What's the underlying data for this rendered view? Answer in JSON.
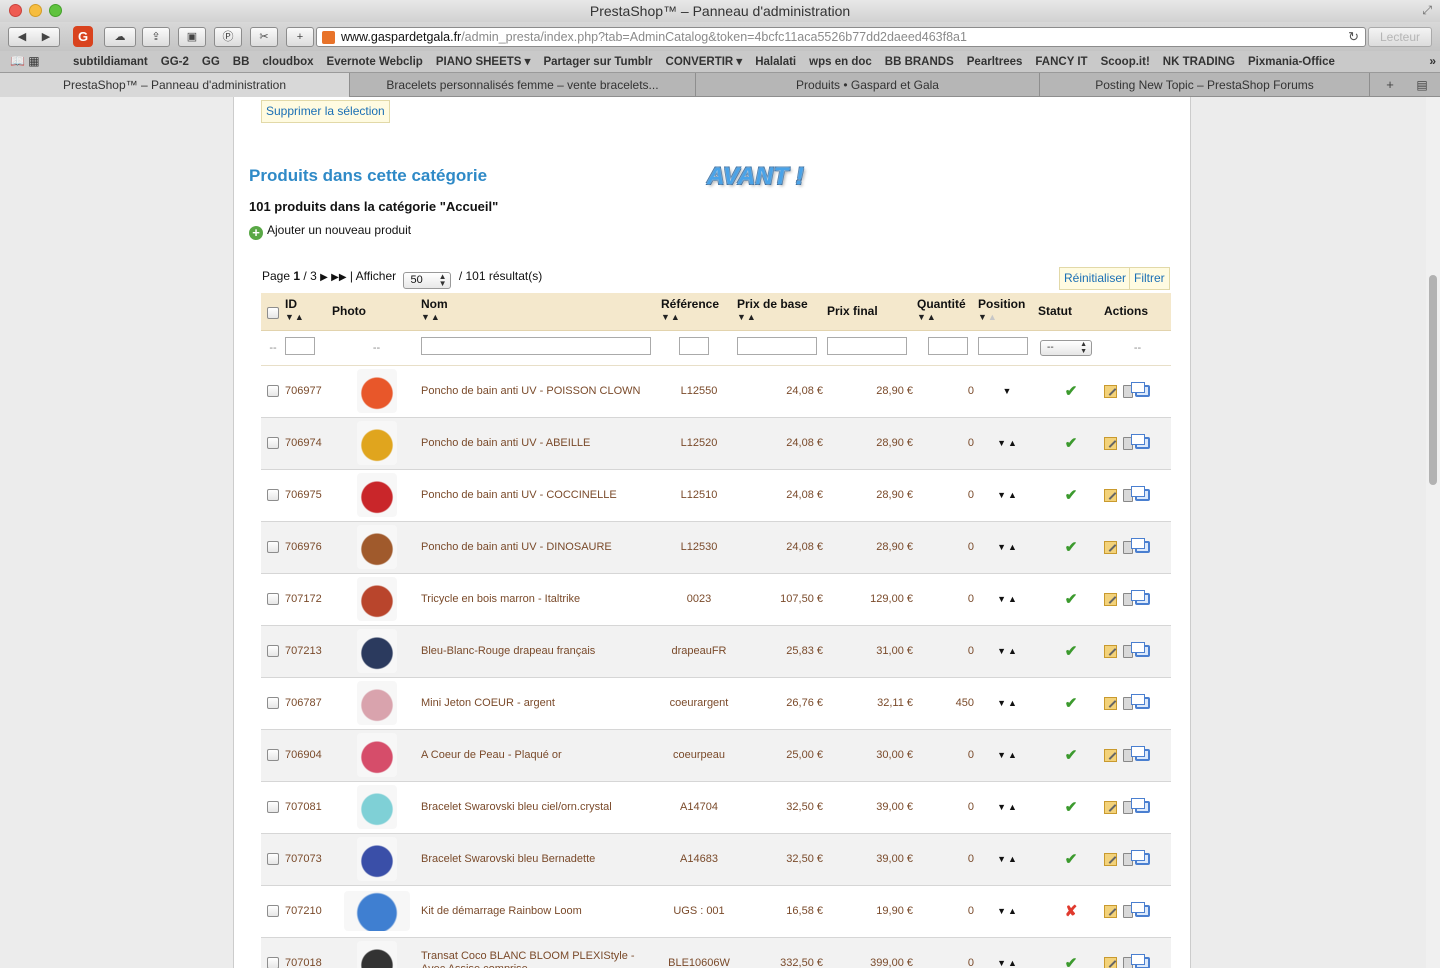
{
  "window": {
    "title": "PrestaShop™ – Panneau d'administration"
  },
  "toolbar": {
    "url_host": "www.gaspardetgala.fr",
    "url_path": "/admin_presta/index.php?tab=AdminCatalog&token=4bcfc11aca5526b77dd2daeed463f8a1",
    "reader_label": "Lecteur"
  },
  "bookmarks": [
    "subtildiamant",
    "GG-2",
    "GG",
    "BB",
    "cloudbox",
    "Evernote Webclip",
    "PIANO SHEETS ▾",
    "Partager sur Tumblr",
    "CONVERTIR ▾",
    "Halalati",
    "wps en doc",
    "BB BRANDS",
    "Pearltrees",
    "FANCY IT",
    "Scoop.it!",
    "NK TRADING",
    "Pixmania-Office"
  ],
  "tabs": [
    {
      "label": "PrestaShop™ – Panneau d'administration",
      "active": true
    },
    {
      "label": "Bracelets personnalisés femme – vente bracelets...",
      "active": false
    },
    {
      "label": "Produits • Gaspard et Gala",
      "active": false
    },
    {
      "label": "Posting New Topic – PrestaShop Forums",
      "active": false
    }
  ],
  "page": {
    "delete_selection": "Supprimer la sélection",
    "section_title": "Produits dans cette catégorie",
    "annotation": "AVANT !",
    "subtitle": "101 produits dans la catégorie \"Accueil\"",
    "add_product": "Ajouter un nouveau produit",
    "pager": {
      "page_label": "Page",
      "current": "1",
      "total": "/ 3",
      "show_label": "| Afficher",
      "per_page": "50",
      "results": "/ 101 résultat(s)"
    },
    "reset_label": "Réinitialiser",
    "filter_label": "Filtrer"
  },
  "table": {
    "headers": {
      "id": "ID",
      "photo": "Photo",
      "name": "Nom",
      "reference": "Référence",
      "base_price": "Prix de base",
      "final_price": "Prix final",
      "quantity": "Quantité",
      "position": "Position",
      "status": "Statut",
      "actions": "Actions"
    },
    "filter_placeholder": "--",
    "status_filter": "--",
    "rows": [
      {
        "id": "706977",
        "name": "Poncho de bain anti UV - POISSON CLOWN",
        "reference": "L12550",
        "base_price": "24,08 €",
        "final_price": "28,90 €",
        "quantity": "0",
        "position": "▼",
        "status": "✔",
        "thumb_color": "#e8572a"
      },
      {
        "id": "706974",
        "name": "Poncho de bain anti UV - ABEILLE",
        "reference": "L12520",
        "base_price": "24,08 €",
        "final_price": "28,90 €",
        "quantity": "0",
        "position": "▼▲",
        "status": "✔",
        "thumb_color": "#e0a51e"
      },
      {
        "id": "706975",
        "name": "Poncho de bain anti UV - COCCINELLE",
        "reference": "L12510",
        "base_price": "24,08 €",
        "final_price": "28,90 €",
        "quantity": "0",
        "position": "▼▲",
        "status": "✔",
        "thumb_color": "#c9262a"
      },
      {
        "id": "706976",
        "name": "Poncho de bain anti UV - DINOSAURE",
        "reference": "L12530",
        "base_price": "24,08 €",
        "final_price": "28,90 €",
        "quantity": "0",
        "position": "▼▲",
        "status": "✔",
        "thumb_color": "#a05a2c"
      },
      {
        "id": "707172",
        "name": "Tricycle en bois marron - Italtrike",
        "reference": "0023",
        "base_price": "107,50 €",
        "final_price": "129,00 €",
        "quantity": "0",
        "position": "▼▲",
        "status": "✔",
        "thumb_color": "#b9452c"
      },
      {
        "id": "707213",
        "name": "Bleu-Blanc-Rouge drapeau français",
        "reference": "drapeauFR",
        "base_price": "25,83 €",
        "final_price": "31,00 €",
        "quantity": "0",
        "position": "▼▲",
        "status": "✔",
        "thumb_color": "#2b3a5e"
      },
      {
        "id": "706787",
        "name": "Mini Jeton COEUR - argent",
        "reference": "coeurargent",
        "base_price": "26,76 €",
        "final_price": "32,11 €",
        "quantity": "450",
        "position": "▼▲",
        "status": "✔",
        "thumb_color": "#d9a3ad"
      },
      {
        "id": "706904",
        "name": "A Coeur de Peau - Plaqué or",
        "reference": "coeurpeau",
        "base_price": "25,00 €",
        "final_price": "30,00 €",
        "quantity": "0",
        "position": "▼▲",
        "status": "✔",
        "thumb_color": "#d64d6a"
      },
      {
        "id": "707081",
        "name": "Bracelet Swarovski bleu ciel/orn.crystal",
        "reference": "A14704",
        "base_price": "32,50 €",
        "final_price": "39,00 €",
        "quantity": "0",
        "position": "▼▲",
        "status": "✔",
        "thumb_color": "#7fd0d6"
      },
      {
        "id": "707073",
        "name": "Bracelet Swarovski bleu Bernadette",
        "reference": "A14683",
        "base_price": "32,50 €",
        "final_price": "39,00 €",
        "quantity": "0",
        "position": "▼▲",
        "status": "✔",
        "thumb_color": "#3a4fa8"
      },
      {
        "id": "707210",
        "name": "Kit de démarrage Rainbow Loom",
        "reference": "UGS : 001",
        "base_price": "16,58 €",
        "final_price": "19,90 €",
        "quantity": "0",
        "position": "▼▲",
        "status": "✘",
        "thumb_color": "#3f7fd1"
      },
      {
        "id": "707018",
        "name": "Transat Coco BLANC BLOOM PLEXIStyle - Avec Assise comprise",
        "reference": "BLE10606W",
        "base_price": "332,50 €",
        "final_price": "399,00 €",
        "quantity": "0",
        "position": "▼▲",
        "status": "✔",
        "thumb_color": "#333333"
      }
    ]
  }
}
